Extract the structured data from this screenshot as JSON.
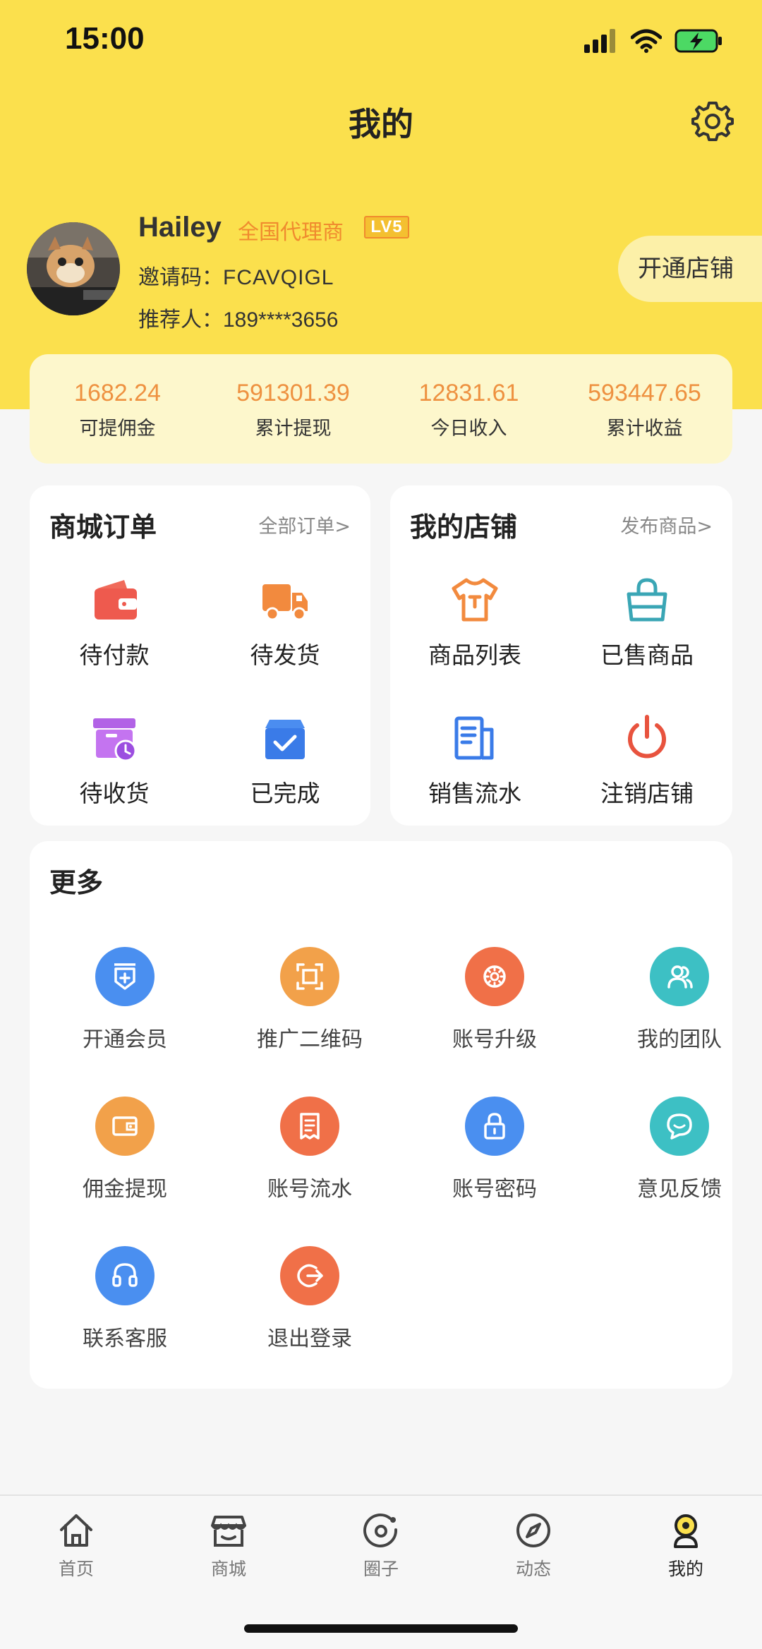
{
  "status_bar": {
    "time": "15:00"
  },
  "header": {
    "title": "我的"
  },
  "profile": {
    "name": "Hailey",
    "role": "全国代理商",
    "level": "LV5",
    "invite_label": "邀请码：",
    "invite_code": "FCAVQIGL",
    "referrer_label": "推荐人：",
    "referrer_phone": "189****3656",
    "open_shop_label": "开通店铺"
  },
  "stats": [
    {
      "value": "1682.24",
      "label": "可提佣金"
    },
    {
      "value": "591301.39",
      "label": "累计提现"
    },
    {
      "value": "12831.61",
      "label": "今日收入"
    },
    {
      "value": "593447.65",
      "label": "累计收益"
    }
  ],
  "mall_orders": {
    "title": "商城订单",
    "link": "全部订单>",
    "items": [
      {
        "label": "待付款",
        "icon": "wallet-icon"
      },
      {
        "label": "待发货",
        "icon": "truck-icon"
      },
      {
        "label": "待收货",
        "icon": "box-clock-icon"
      },
      {
        "label": "已完成",
        "icon": "bag-check-icon"
      }
    ]
  },
  "my_shop": {
    "title": "我的店铺",
    "link": "发布商品>",
    "items": [
      {
        "label": "商品列表",
        "icon": "tshirt-icon"
      },
      {
        "label": "已售商品",
        "icon": "shopping-bag-icon"
      },
      {
        "label": "销售流水",
        "icon": "document-list-icon"
      },
      {
        "label": "注销店铺",
        "icon": "power-icon"
      }
    ]
  },
  "more": {
    "title": "更多",
    "items": [
      {
        "label": "开通会员",
        "icon": "vip-shield-icon",
        "color": "#4a8ff0"
      },
      {
        "label": "推广二维码",
        "icon": "scan-frame-icon",
        "color": "#f2a14a"
      },
      {
        "label": "账号升级",
        "icon": "gear-badge-icon",
        "color": "#f07048"
      },
      {
        "label": "我的团队",
        "icon": "team-icon",
        "color": "#3dc0c4"
      },
      {
        "label": "佣金提现",
        "icon": "wallet-icon",
        "color": "#f2a14a"
      },
      {
        "label": "账号流水",
        "icon": "receipt-icon",
        "color": "#f07048"
      },
      {
        "label": "账号密码",
        "icon": "lock-icon",
        "color": "#4a8ff0"
      },
      {
        "label": "意见反馈",
        "icon": "chat-icon",
        "color": "#3dc0c4"
      },
      {
        "label": "联系客服",
        "icon": "headset-icon",
        "color": "#4a8ff0"
      },
      {
        "label": "退出登录",
        "icon": "logout-icon",
        "color": "#f07048"
      }
    ]
  },
  "tab_bar": [
    {
      "label": "首页",
      "icon": "home-icon"
    },
    {
      "label": "商城",
      "icon": "store-icon"
    },
    {
      "label": "圈子",
      "icon": "circle-icon"
    },
    {
      "label": "动态",
      "icon": "compass-icon"
    },
    {
      "label": "我的",
      "icon": "profile-icon",
      "active": true
    }
  ]
}
